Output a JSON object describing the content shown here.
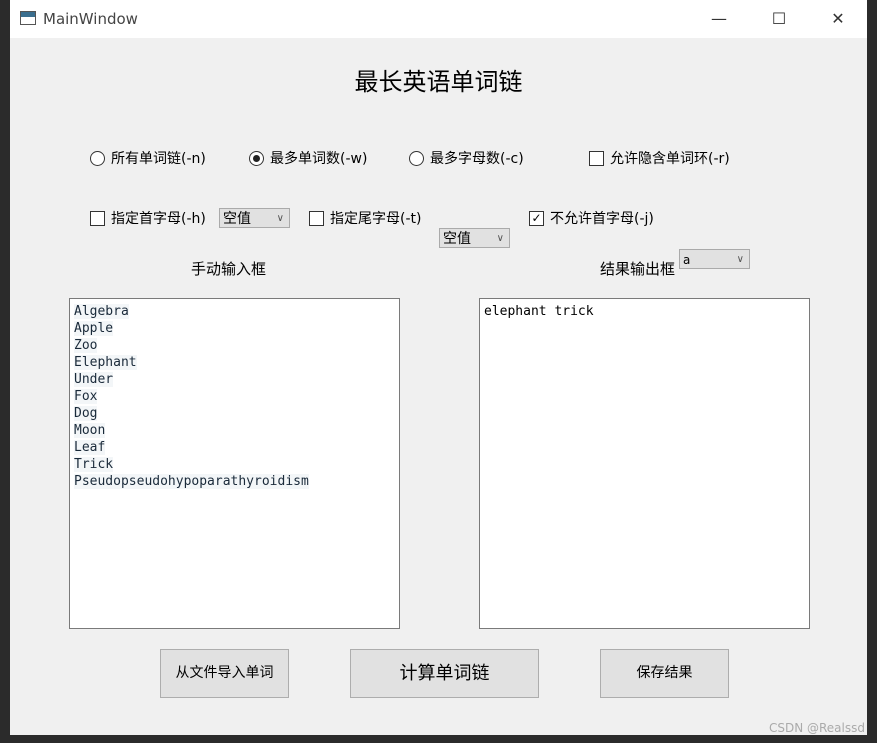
{
  "window": {
    "title": "MainWindow",
    "minimize": "—",
    "maximize": "☐",
    "close": "✕"
  },
  "heading": "最长英语单词链",
  "options": {
    "radios": [
      {
        "label": "所有单词链(-n)",
        "checked": false
      },
      {
        "label": "最多单词数(-w)",
        "checked": true
      },
      {
        "label": "最多字母数(-c)",
        "checked": false
      }
    ],
    "allow_cycle": {
      "label": "允许隐含单词环(-r)",
      "checked": false
    },
    "head": {
      "label": "指定首字母(-h)",
      "checked": false,
      "value": "空值"
    },
    "tail": {
      "label": "指定尾字母(-t)",
      "checked": false,
      "value": "空值"
    },
    "no_head": {
      "label": "不允许首字母(-j)",
      "checked": true,
      "value": "a"
    }
  },
  "input": {
    "label": "手动输入框",
    "lines": [
      "Algebra",
      "Apple",
      "Zoo",
      "Elephant",
      "Under",
      "Fox",
      "Dog",
      "Moon",
      "Leaf",
      "Trick",
      "Pseudopseudohypoparathyroidism"
    ]
  },
  "output": {
    "label": "结果输出框",
    "text": "elephant trick"
  },
  "buttons": {
    "import": "从文件导入单词",
    "compute": "计算单词链",
    "save": "保存结果"
  },
  "watermark": "CSDN @Realssd"
}
